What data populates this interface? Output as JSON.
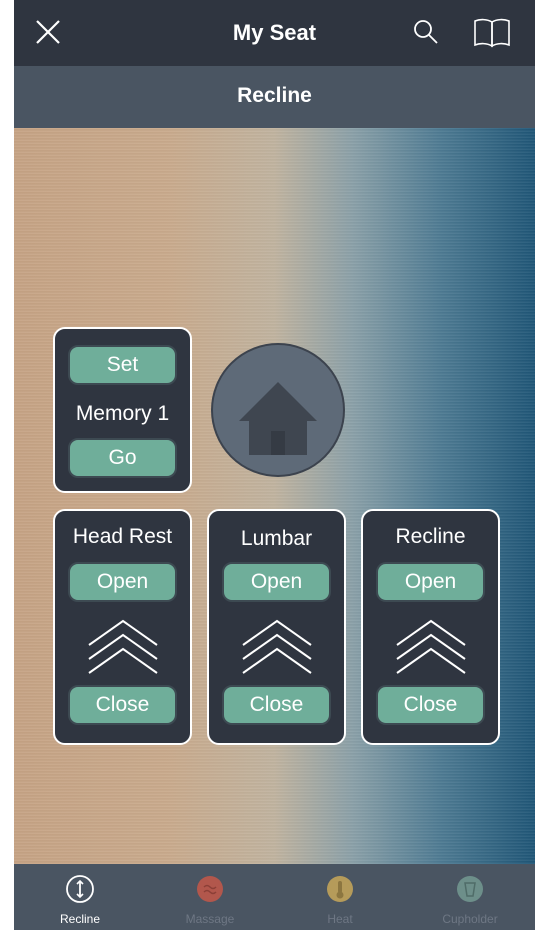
{
  "header": {
    "title": "My Seat"
  },
  "subheader": {
    "title": "Recline"
  },
  "memory": {
    "set_label": "Set",
    "title": "Memory 1",
    "go_label": "Go"
  },
  "controls": [
    {
      "title": "Head Rest",
      "open_label": "Open",
      "close_label": "Close"
    },
    {
      "title": "Lumbar",
      "open_label": "Open",
      "close_label": "Close"
    },
    {
      "title": "Recline",
      "open_label": "Open",
      "close_label": "Close"
    }
  ],
  "tabs": [
    {
      "label": "Recline",
      "icon": "recline-icon",
      "color": "#ffffff",
      "active": true
    },
    {
      "label": "Massage",
      "icon": "massage-icon",
      "color": "#b2574c",
      "active": false
    },
    {
      "label": "Heat",
      "icon": "heat-icon",
      "color": "#b59b5a",
      "active": false
    },
    {
      "label": "Cupholder",
      "icon": "cupholder-icon",
      "color": "#6d8f8a",
      "active": false
    }
  ],
  "colors": {
    "navbar": "#2f3540",
    "subbar": "#4a5562",
    "card": "#2f3540",
    "button": "#6fae9a",
    "home_button": "#5e6a78"
  }
}
